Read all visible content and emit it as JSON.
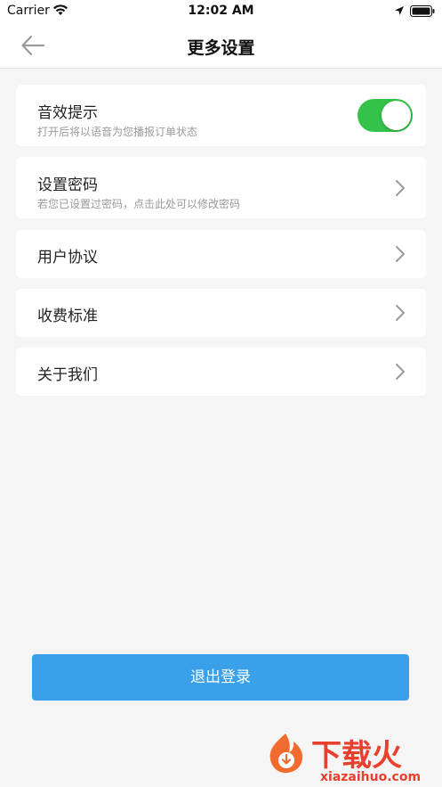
{
  "status": {
    "carrier": "Carrier",
    "time": "12:02 AM"
  },
  "nav": {
    "title": "更多设置"
  },
  "settings": [
    {
      "title": "音效提示",
      "subtitle": "打开后将以语音为您播报订单状态",
      "toggle_on": true
    },
    {
      "title": "设置密码",
      "subtitle": "若您已设置过密码，点击此处可以修改密码"
    },
    {
      "title": "用户协议"
    },
    {
      "title": "收费标准"
    },
    {
      "title": "关于我们"
    }
  ],
  "logout": {
    "label": "退出登录"
  },
  "watermark": {
    "brand": "下载火",
    "url": "xiazaihuo.com"
  },
  "colors": {
    "accent": "#3aa0ea",
    "toggle": "#35c24a",
    "background": "#f5f5f5"
  }
}
